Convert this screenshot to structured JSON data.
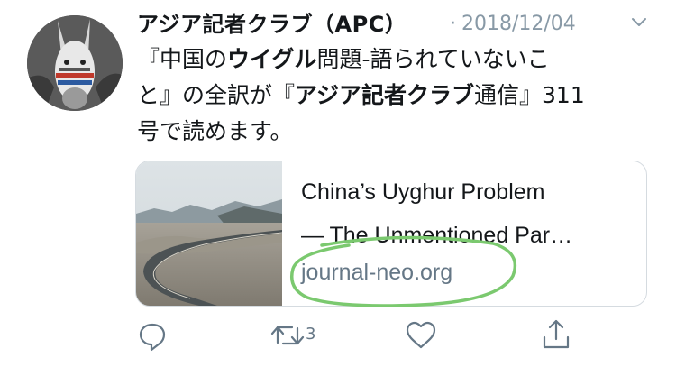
{
  "tweet": {
    "author": "アジア記者クラブ（APC）",
    "separator": "·",
    "date": "2018/12/04",
    "text_lines": [
      [
        "『中国の",
        "ウイグル",
        "問題-語られていないこ"
      ],
      [
        "と』の全訳が『",
        "アジア記者クラブ",
        "通信』311"
      ],
      [
        "号で読めます。"
      ]
    ]
  },
  "card": {
    "title_line1": "China’s Uyghur Problem",
    "title_line2": "— The Unmentioned Par…",
    "domain": "journal-neo.org"
  },
  "actions": {
    "retweet_count": "3",
    "icons": [
      "reply-icon",
      "retweet-icon",
      "like-icon",
      "share-icon"
    ]
  },
  "colors": {
    "text": "#14171a",
    "muted": "#8899a6",
    "card_border": "#d5dbe0",
    "highlight_circle": "#7bc96f"
  }
}
